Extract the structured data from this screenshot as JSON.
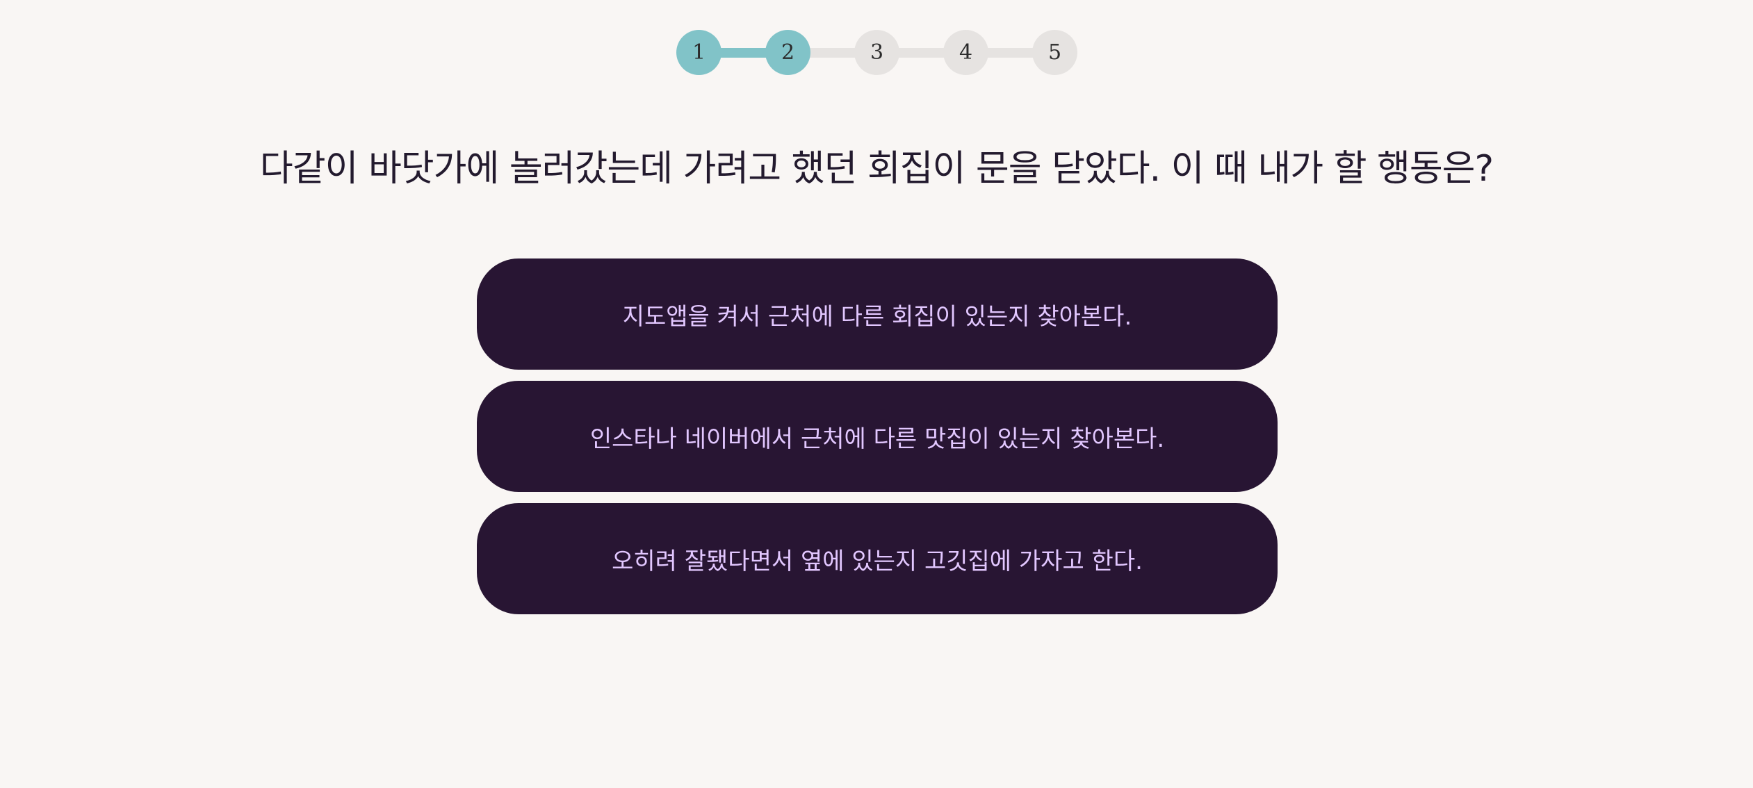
{
  "progress": {
    "steps": [
      "1",
      "2",
      "3",
      "4",
      "5"
    ],
    "current_step": 2,
    "colors": {
      "active": "#81c3c8",
      "inactive": "#e6e3e1"
    }
  },
  "question": "다같이 바닷가에 놀러갔는데 가려고 했던 회집이 문을 닫았다. 이 때 내가 할 행동은?",
  "answers": [
    "지도앱을 켜서 근처에 다른 회집이 있는지 찾아본다.",
    "인스타나 네이버에서 근처에 다른 맛집이 있는지 찾아본다.",
    "오히려 잘됐다면서 옆에 있는지 고깃집에 가자고 한다."
  ],
  "colors": {
    "background": "#f9f6f4",
    "answer_bg": "#281533",
    "answer_text": "#e2c7ff",
    "question_text": "#231a2e"
  }
}
